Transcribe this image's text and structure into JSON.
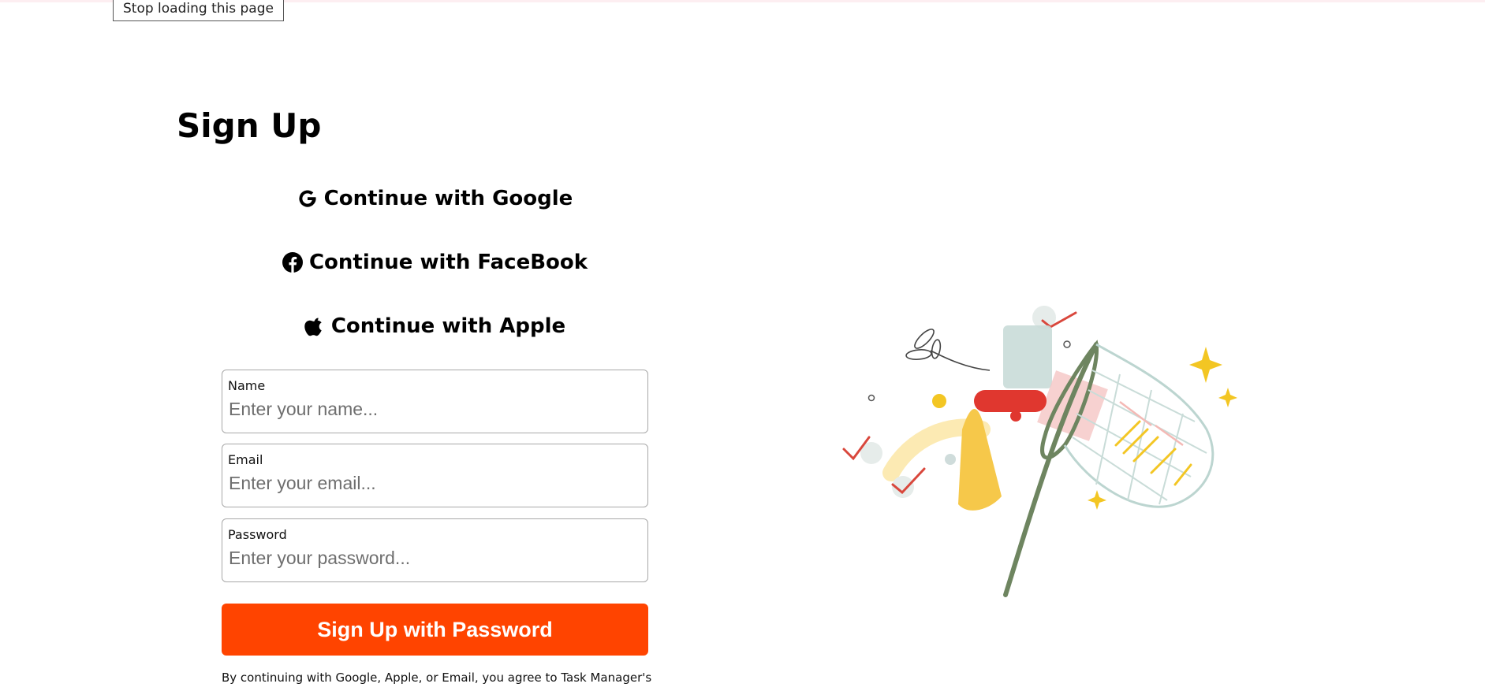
{
  "stop_loading_label": "Stop loading this page",
  "title": "Sign Up",
  "oauth": {
    "google": {
      "label": "Continue with Google",
      "icon": "google-icon"
    },
    "facebook": {
      "label": "Continue with FaceBook",
      "icon": "facebook-icon"
    },
    "apple": {
      "label": "Continue with Apple",
      "icon": "apple-icon"
    }
  },
  "form": {
    "name": {
      "label": "Name",
      "placeholder": "Enter your name..."
    },
    "email": {
      "label": "Email",
      "placeholder": "Enter your email..."
    },
    "password": {
      "label": "Password",
      "placeholder": "Enter your password..."
    },
    "submit_label": "Sign Up with Password"
  },
  "legal_text": "By continuing with Google, Apple, or Email, you agree to Task Manager's Terms of Service and Privacy Policy.",
  "colors": {
    "accent": "#ff4400",
    "background": "#ffffff",
    "text": "#000000"
  },
  "illustration": {
    "icon": "butterfly-net-illustration"
  }
}
